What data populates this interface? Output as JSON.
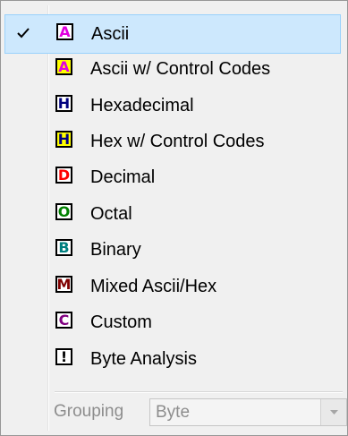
{
  "menu": {
    "items": [
      {
        "label": "Ascii",
        "badge": "A",
        "checked": true,
        "badge_fg": "#e000e0",
        "badge_bg": "#ffffff",
        "icon": "ascii-icon"
      },
      {
        "label": "Ascii w/ Control Codes",
        "badge": "A",
        "checked": false,
        "badge_fg": "#e000e0",
        "badge_bg": "#ffff00",
        "icon": "ascii-control-codes-icon"
      },
      {
        "label": "Hexadecimal",
        "badge": "H",
        "checked": false,
        "badge_fg": "#000080",
        "badge_bg": "#ffffff",
        "icon": "hexadecimal-icon"
      },
      {
        "label": "Hex w/ Control Codes",
        "badge": "H",
        "checked": false,
        "badge_fg": "#000080",
        "badge_bg": "#ffff00",
        "icon": "hex-control-codes-icon"
      },
      {
        "label": "Decimal",
        "badge": "D",
        "checked": false,
        "badge_fg": "#ff0000",
        "badge_bg": "#ffffff",
        "icon": "decimal-icon"
      },
      {
        "label": "Octal",
        "badge": "O",
        "checked": false,
        "badge_fg": "#008000",
        "badge_bg": "#ffffff",
        "icon": "octal-icon"
      },
      {
        "label": "Binary",
        "badge": "B",
        "checked": false,
        "badge_fg": "#008080",
        "badge_bg": "#ffffff",
        "icon": "binary-icon"
      },
      {
        "label": "Mixed Ascii/Hex",
        "badge": "M",
        "checked": false,
        "badge_fg": "#800000",
        "badge_bg": "#ffffff",
        "icon": "mixed-ascii-hex-icon"
      },
      {
        "label": "Custom",
        "badge": "C",
        "checked": false,
        "badge_fg": "#800080",
        "badge_bg": "#ffffff",
        "icon": "custom-icon"
      },
      {
        "label": "Byte Analysis",
        "badge": "!",
        "checked": false,
        "badge_fg": "#000000",
        "badge_bg": "#ffffff",
        "icon": "byte-analysis-icon"
      }
    ]
  },
  "grouping": {
    "label": "Grouping",
    "value": "Byte"
  }
}
